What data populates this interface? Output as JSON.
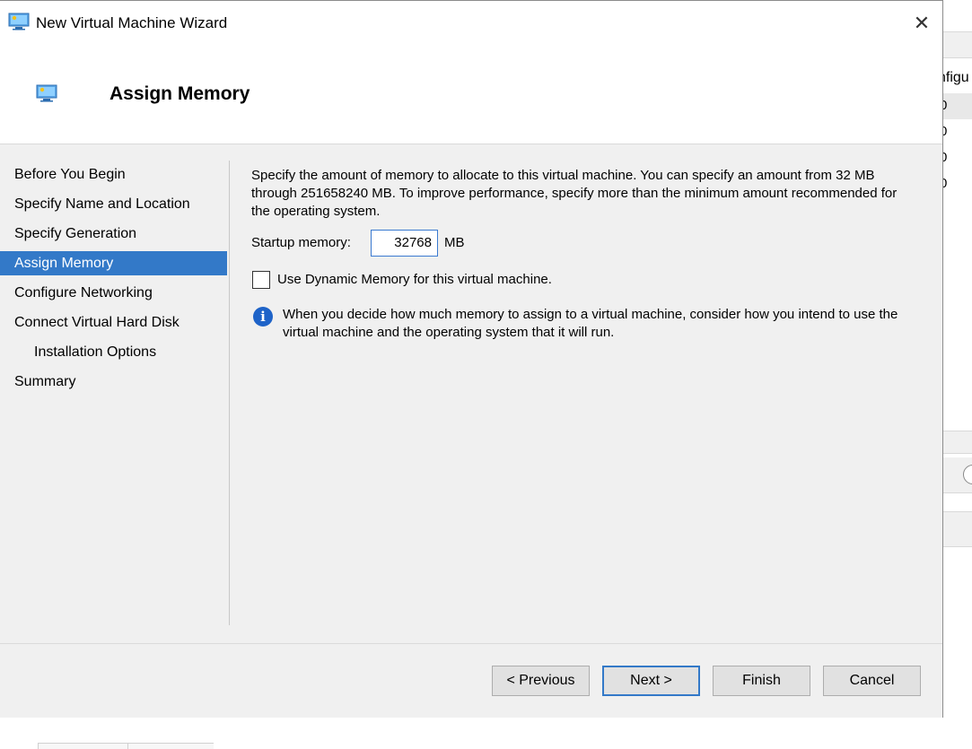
{
  "window": {
    "title": "New Virtual Machine Wizard",
    "close_glyph": "✕",
    "app_icon": "virtual-machine-icon"
  },
  "header": {
    "title": "Assign Memory",
    "icon": "virtual-machine-icon"
  },
  "nav": {
    "items": [
      {
        "label": "Before You Begin"
      },
      {
        "label": "Specify Name and Location"
      },
      {
        "label": "Specify Generation"
      },
      {
        "label": "Assign Memory",
        "active": true
      },
      {
        "label": "Configure Networking"
      },
      {
        "label": "Connect Virtual Hard Disk"
      },
      {
        "label": "Installation Options",
        "sub": true
      },
      {
        "label": "Summary"
      }
    ]
  },
  "content": {
    "description": "Specify the amount of memory to allocate to this virtual machine. You can specify an amount from 32 MB through 251658240 MB. To improve performance, specify more than the minimum amount recommended for the operating system.",
    "startup_memory_label": "Startup memory:",
    "startup_memory_value": "32768",
    "startup_memory_unit": "MB",
    "dynamic_memory_label": "Use Dynamic Memory for this virtual machine.",
    "dynamic_memory_checked": false,
    "info_icon": "info-icon",
    "info_text": "When you decide how much memory to assign to a virtual machine, consider how you intend to use the virtual machine and the operating system that it will run."
  },
  "buttons": {
    "previous": "< Previous",
    "next": "Next >",
    "finish": "Finish",
    "cancel": "Cancel"
  },
  "background_window": {
    "header_fragment": "nfigu",
    "rows": [
      "0",
      "0",
      "0",
      "0"
    ]
  },
  "colors": {
    "accent": "#3379c8",
    "dialog_bg": "#f0f0f0",
    "info_blue": "#1e63c8"
  }
}
